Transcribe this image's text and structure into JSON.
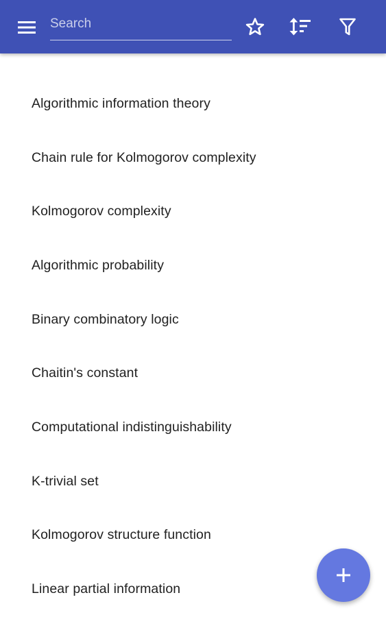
{
  "toolbar": {
    "background_color": "#3f51b5",
    "menu_icon": "hamburger-menu-icon",
    "search": {
      "placeholder": "Search",
      "value": ""
    },
    "actions": [
      {
        "name": "favorites",
        "icon": "star-outline-icon"
      },
      {
        "name": "sort",
        "icon": "sort-icon"
      },
      {
        "name": "filter",
        "icon": "filter-icon"
      }
    ]
  },
  "articles": {
    "items": [
      "Algorithmic information theory",
      "Chain rule for Kolmogorov complexity",
      "Kolmogorov complexity",
      "Algorithmic probability",
      "Binary combinatory logic",
      "Chaitin's constant",
      "Computational indistinguishability",
      "K-trivial set",
      "Kolmogorov structure function",
      "Linear partial information"
    ]
  },
  "fab": {
    "icon": "plus-icon",
    "color": "#6478e0"
  }
}
